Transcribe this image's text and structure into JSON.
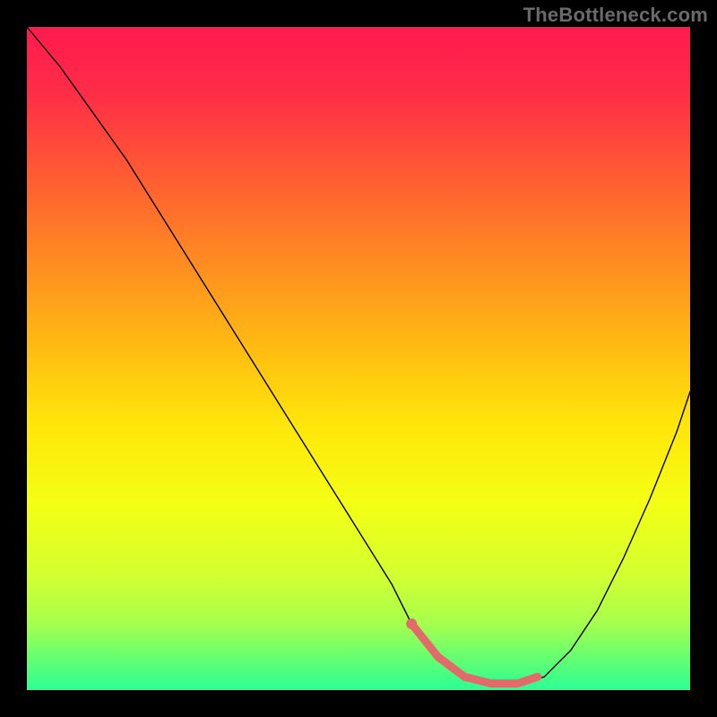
{
  "watermark": {
    "text": "TheBottleneck.com"
  },
  "gradient": {
    "stops": [
      {
        "offset": 0.0,
        "color": "#ff1a4f"
      },
      {
        "offset": 0.1,
        "color": "#ff2d47"
      },
      {
        "offset": 0.22,
        "color": "#ff5a33"
      },
      {
        "offset": 0.35,
        "color": "#ff8a22"
      },
      {
        "offset": 0.48,
        "color": "#ffba12"
      },
      {
        "offset": 0.6,
        "color": "#ffe60a"
      },
      {
        "offset": 0.72,
        "color": "#f3ff14"
      },
      {
        "offset": 0.82,
        "color": "#d6ff2e"
      },
      {
        "offset": 0.9,
        "color": "#a6ff4d"
      },
      {
        "offset": 0.95,
        "color": "#66ff70"
      },
      {
        "offset": 1.0,
        "color": "#2bff94"
      }
    ]
  },
  "chart_data": {
    "type": "line",
    "title": "",
    "xlabel": "",
    "ylabel": "",
    "xlim": [
      0,
      100
    ],
    "ylim": [
      0,
      100
    ],
    "series": [
      {
        "name": "curve",
        "color": "#000000",
        "width": 1.4,
        "x": [
          0,
          5,
          10,
          15,
          20,
          25,
          30,
          35,
          40,
          45,
          50,
          55,
          58,
          62,
          66,
          70,
          74,
          78,
          82,
          86,
          90,
          94,
          98,
          100
        ],
        "y": [
          100,
          94,
          87,
          80,
          72,
          64,
          56,
          48,
          40,
          32,
          24,
          16,
          10,
          5,
          2,
          1,
          1,
          2,
          6,
          12,
          20,
          29,
          39,
          45
        ]
      },
      {
        "name": "highlight",
        "color": "#e36a6a",
        "width": 9,
        "x": [
          58,
          62,
          66,
          70,
          74,
          77
        ],
        "y": [
          10,
          5,
          2,
          1,
          1,
          2
        ]
      }
    ],
    "markers": [
      {
        "name": "highlight-start-dot",
        "x": 58,
        "y": 10,
        "r": 6,
        "color": "#e36a6a"
      }
    ]
  }
}
